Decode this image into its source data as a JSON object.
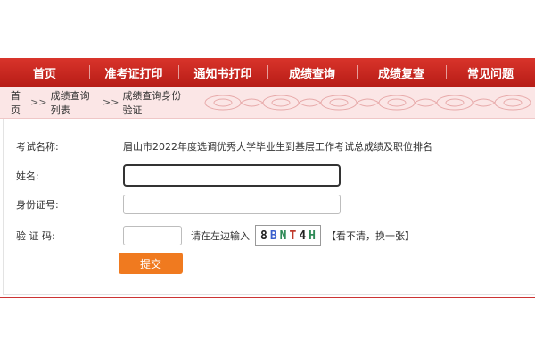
{
  "nav": {
    "items": [
      {
        "label": "首页"
      },
      {
        "label": "准考证打印"
      },
      {
        "label": "通知书打印"
      },
      {
        "label": "成绩查询"
      },
      {
        "label": "成绩复查"
      },
      {
        "label": "常见问题"
      }
    ]
  },
  "breadcrumb": {
    "items": [
      "首页",
      "成绩查询列表",
      "成绩查询身份验证"
    ],
    "separator": ">>"
  },
  "form": {
    "exam_label": "考试名称:",
    "exam_name": "眉山市2022年度选调优秀大学毕业生到基层工作考试总成绩及职位排名",
    "name_label": "姓名:",
    "name_value": "",
    "id_label": "身份证号:",
    "id_value": "",
    "captcha_label": "验 证 码:",
    "captcha_value": "",
    "captcha_hint": "请在左边输入",
    "captcha_chars": [
      {
        "char": "8",
        "color": "#222222"
      },
      {
        "char": "B",
        "color": "#3a5fcd"
      },
      {
        "char": "N",
        "color": "#2e8b57"
      },
      {
        "char": "T",
        "color": "#c0392b"
      },
      {
        "char": "4",
        "color": "#222222"
      },
      {
        "char": "H",
        "color": "#2e8b57"
      }
    ],
    "refresh_text": "【看不清，换一张】",
    "submit_label": "提交"
  },
  "colors": {
    "nav_red": "#c8231c",
    "submit_orange": "#f07a1f",
    "breadcrumb_bg": "#fbe6e6"
  }
}
